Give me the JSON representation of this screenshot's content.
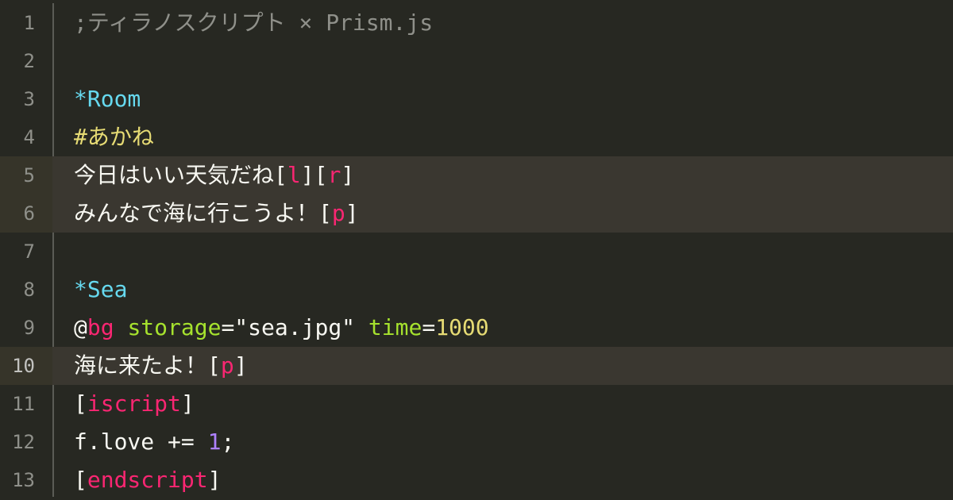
{
  "editor": {
    "lines": [
      {
        "num": "1",
        "segments": [
          {
            "text": ";ティラノスクリプト × Prism.js",
            "cls": "c-comment"
          }
        ]
      },
      {
        "num": "2",
        "segments": []
      },
      {
        "num": "3",
        "segments": [
          {
            "text": "*Room",
            "cls": "c-label"
          }
        ]
      },
      {
        "num": "4",
        "segments": [
          {
            "text": "#あかね",
            "cls": "c-chara"
          }
        ]
      },
      {
        "num": "5",
        "segments": [
          {
            "text": "今日はいい天気だね",
            "cls": "c-text"
          },
          {
            "text": "[",
            "cls": "c-punct"
          },
          {
            "text": "l",
            "cls": "c-tag"
          },
          {
            "text": "][",
            "cls": "c-punct"
          },
          {
            "text": "r",
            "cls": "c-tag"
          },
          {
            "text": "]",
            "cls": "c-punct"
          }
        ]
      },
      {
        "num": "6",
        "segments": [
          {
            "text": "みんなで海に行こうよ！",
            "cls": "c-text"
          },
          {
            "text": "[",
            "cls": "c-punct"
          },
          {
            "text": "p",
            "cls": "c-tag"
          },
          {
            "text": "]",
            "cls": "c-punct"
          }
        ]
      },
      {
        "num": "7",
        "segments": []
      },
      {
        "num": "8",
        "segments": [
          {
            "text": "*Sea",
            "cls": "c-label"
          }
        ]
      },
      {
        "num": "9",
        "segments": [
          {
            "text": "@",
            "cls": "c-punct"
          },
          {
            "text": "bg",
            "cls": "c-tag"
          },
          {
            "text": " ",
            "cls": "c-text"
          },
          {
            "text": "storage",
            "cls": "c-attr"
          },
          {
            "text": "=\"sea.jpg\"",
            "cls": "c-str"
          },
          {
            "text": " ",
            "cls": "c-text"
          },
          {
            "text": "time",
            "cls": "c-attr"
          },
          {
            "text": "=",
            "cls": "c-punct"
          },
          {
            "text": "1000",
            "cls": "c-val"
          }
        ]
      },
      {
        "num": "10",
        "segments": [
          {
            "text": "海に来たよ！",
            "cls": "c-text"
          },
          {
            "text": "[",
            "cls": "c-punct"
          },
          {
            "text": "p",
            "cls": "c-tag"
          },
          {
            "text": "]",
            "cls": "c-punct"
          }
        ]
      },
      {
        "num": "11",
        "segments": [
          {
            "text": "[",
            "cls": "c-punct"
          },
          {
            "text": "iscript",
            "cls": "c-tag"
          },
          {
            "text": "]",
            "cls": "c-punct"
          }
        ]
      },
      {
        "num": "12",
        "segments": [
          {
            "text": "f.love += ",
            "cls": "c-text"
          },
          {
            "text": "1",
            "cls": "c-num"
          },
          {
            "text": ";",
            "cls": "c-punct"
          }
        ]
      },
      {
        "num": "13",
        "segments": [
          {
            "text": "[",
            "cls": "c-punct"
          },
          {
            "text": "endscript",
            "cls": "c-tag"
          },
          {
            "text": "]",
            "cls": "c-punct"
          }
        ]
      }
    ],
    "highlighted_lines": [
      "5",
      "6",
      "10"
    ],
    "current_line": "10"
  }
}
